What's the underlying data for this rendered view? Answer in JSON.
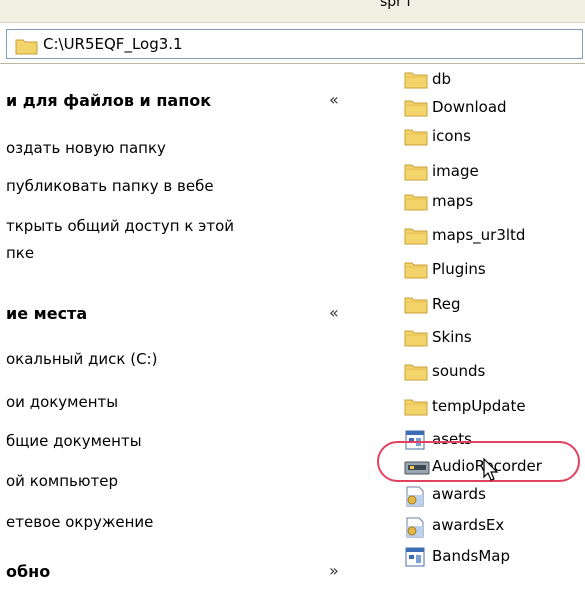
{
  "top_fragment": "spr ſ",
  "address_bar": {
    "path": "C:\\UR5EQF_Log3.1",
    "icon": "folder-icon"
  },
  "tasks_panel": {
    "section1": {
      "title": "и для файлов и папок",
      "chevron": "«",
      "items": [
        "оздать новую папку",
        "публиковать папку в вебе",
        "ткрыть общий доступ к этой",
        "пке"
      ]
    },
    "section2": {
      "title": "ие места",
      "chevron": "«",
      "items": [
        "окальный диск (C:)",
        "ои документы",
        "бщие документы",
        "ой компьютер",
        "етевое окружение"
      ]
    },
    "section3": {
      "title": "обно",
      "chevron": "»"
    }
  },
  "files": [
    {
      "name": "db",
      "icon": "folder-icon"
    },
    {
      "name": "Download",
      "icon": "folder-icon"
    },
    {
      "name": "icons",
      "icon": "folder-icon"
    },
    {
      "name": "image",
      "icon": "folder-icon"
    },
    {
      "name": "maps",
      "icon": "folder-icon"
    },
    {
      "name": "maps_ur3ltd",
      "icon": "folder-icon"
    },
    {
      "name": "Plugins",
      "icon": "folder-icon"
    },
    {
      "name": "Reg",
      "icon": "folder-icon"
    },
    {
      "name": "Skins",
      "icon": "folder-icon"
    },
    {
      "name": "sounds",
      "icon": "folder-icon"
    },
    {
      "name": "tempUpdate",
      "icon": "folder-icon"
    },
    {
      "name": "asets",
      "icon": "app-window-icon"
    },
    {
      "name": "AudioRecorder",
      "icon": "audio-device-icon",
      "highlighted": true
    },
    {
      "name": "awards",
      "icon": "document-pin-icon"
    },
    {
      "name": "awardsEx",
      "icon": "document-pin-icon"
    },
    {
      "name": "BandsMap",
      "icon": "app-window-icon"
    }
  ],
  "colors": {
    "folder": "#f3d46a",
    "folder_edge": "#c9a23a",
    "highlight": "#e2425f"
  }
}
